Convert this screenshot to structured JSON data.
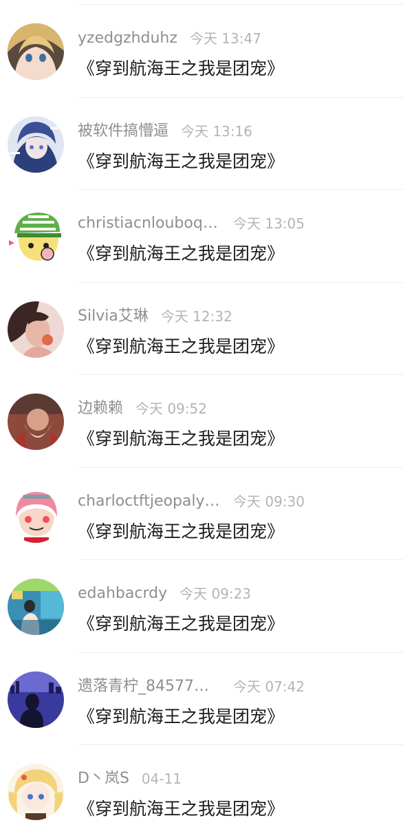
{
  "comments": [
    {
      "user": "yzedgzhduhz",
      "time": "今天 13:47",
      "book": "《穿到航海王之我是团宠》",
      "avatar": "avatar-anime-blonde-girl",
      "truncated": false
    },
    {
      "user": "被软件搞懵逼",
      "time": "今天 13:16",
      "book": "《穿到航海王之我是团宠》",
      "avatar": "avatar-anime-blue-hair-boy",
      "truncated": false
    },
    {
      "user": "christiacnlouboq…",
      "time": "今天 13:05",
      "book": "《穿到航海王之我是团宠》",
      "avatar": "avatar-cartoon-green-hat",
      "truncated": true
    },
    {
      "user": "Silvia艾琳",
      "time": "今天 12:32",
      "book": "《穿到航海王之我是团宠》",
      "avatar": "avatar-photo-woman",
      "truncated": false
    },
    {
      "user": "边赖赖",
      "time": "今天 09:52",
      "book": "《穿到航海王之我是团宠》",
      "avatar": "avatar-photo-red-blur",
      "truncated": false
    },
    {
      "user": "charloctftjeopaly…",
      "time": "今天 09:30",
      "book": "《穿到航海王之我是团宠》",
      "avatar": "avatar-cartoon-pink-hair",
      "truncated": true
    },
    {
      "user": "edahbacrdy",
      "time": "今天 09:23",
      "book": "《穿到航海王之我是团宠》",
      "avatar": "avatar-photo-room",
      "truncated": false
    },
    {
      "user": "遗落青柠_84577…",
      "time": "今天 07:42",
      "book": "《穿到航海王之我是团宠》",
      "avatar": "avatar-photo-night-city",
      "truncated": true
    },
    {
      "user": "D丶岚S",
      "time": "04-11",
      "book": "《穿到航海王之我是团宠》",
      "avatar": "avatar-anime-blonde-twintails",
      "truncated": false
    }
  ],
  "colors": {
    "username": "#8e8e93",
    "time": "#b4b4b9",
    "book": "#1c1c1e",
    "divider": "#ededed"
  }
}
